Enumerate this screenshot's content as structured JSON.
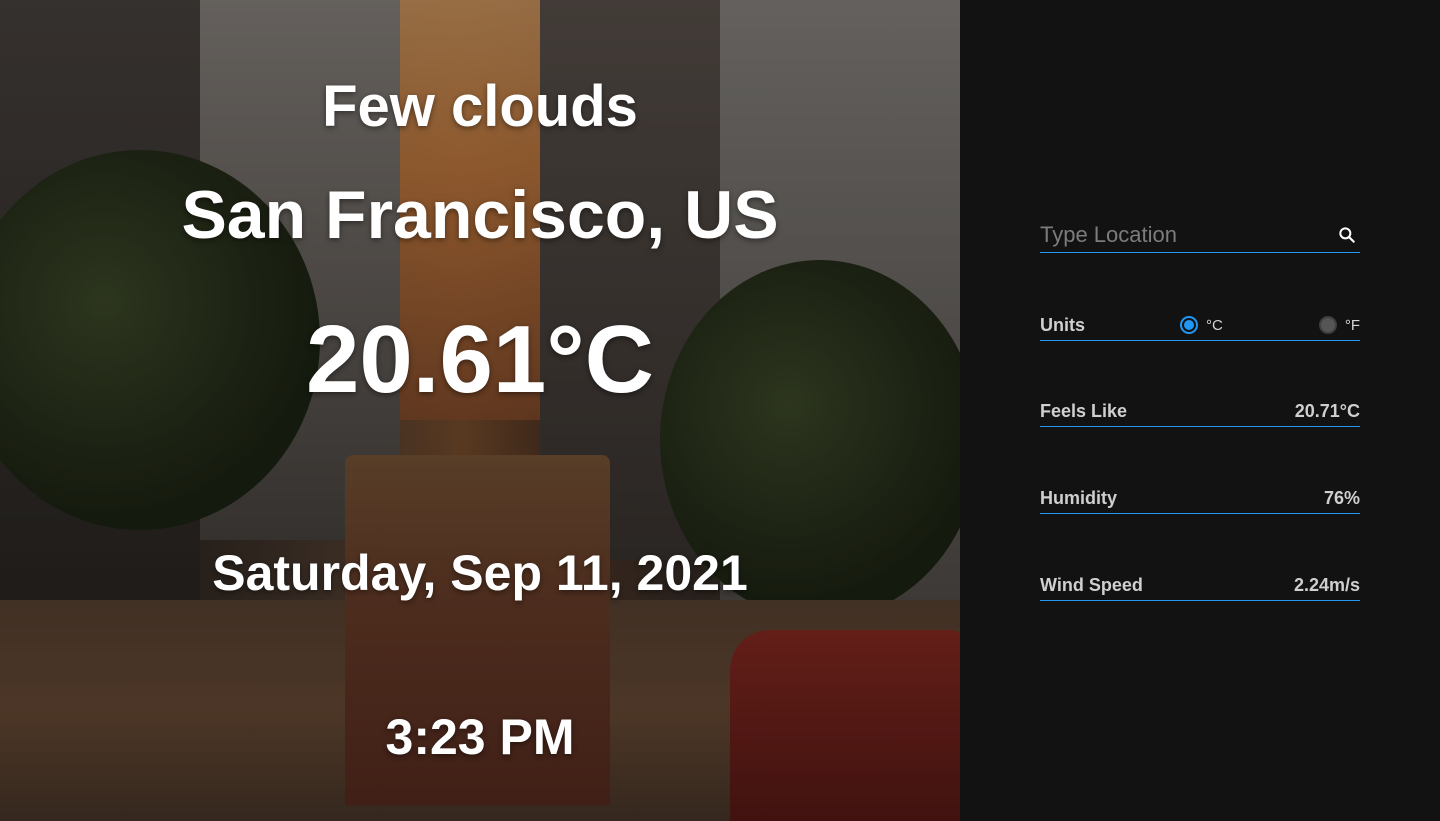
{
  "hero": {
    "condition": "Few clouds",
    "location": "San Francisco, US",
    "temperature": "20.61°C",
    "date": "Saturday, Sep 11, 2021",
    "time": "3:23 PM"
  },
  "sidebar": {
    "search": {
      "placeholder": "Type Location",
      "icon": "search-icon"
    },
    "units": {
      "label": "Units",
      "options": [
        {
          "label": "°C",
          "selected": true
        },
        {
          "label": "°F",
          "selected": false
        }
      ]
    },
    "details": [
      {
        "label": "Feels Like",
        "value": "20.71°C"
      },
      {
        "label": "Humidity",
        "value": "76%"
      },
      {
        "label": "Wind Speed",
        "value": "2.24m/s"
      }
    ]
  },
  "colors": {
    "accent": "#2196f3",
    "sidebar_bg": "#121212",
    "text_primary": "#ffffff",
    "text_secondary": "#cfcfcf"
  }
}
